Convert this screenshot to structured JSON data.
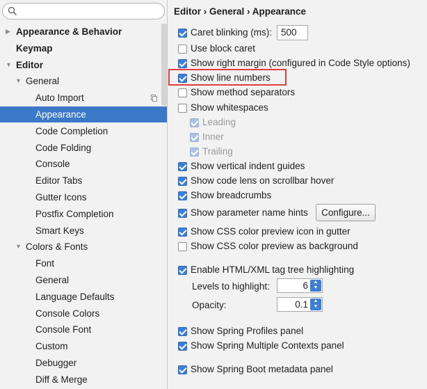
{
  "search": {
    "placeholder": ""
  },
  "tree": {
    "items": [
      {
        "label": "Appearance & Behavior",
        "arrow": "▶"
      },
      {
        "label": "Keymap",
        "arrow": ""
      },
      {
        "label": "Editor",
        "arrow": "▼"
      },
      {
        "label": "General",
        "arrow": "▼"
      },
      {
        "label": "Auto Import",
        "arrow": ""
      },
      {
        "label": "Appearance",
        "arrow": ""
      },
      {
        "label": "Code Completion",
        "arrow": ""
      },
      {
        "label": "Code Folding",
        "arrow": ""
      },
      {
        "label": "Console",
        "arrow": ""
      },
      {
        "label": "Editor Tabs",
        "arrow": ""
      },
      {
        "label": "Gutter Icons",
        "arrow": ""
      },
      {
        "label": "Postfix Completion",
        "arrow": ""
      },
      {
        "label": "Smart Keys",
        "arrow": ""
      },
      {
        "label": "Colors & Fonts",
        "arrow": "▼"
      },
      {
        "label": "Font",
        "arrow": ""
      },
      {
        "label": "General",
        "arrow": ""
      },
      {
        "label": "Language Defaults",
        "arrow": ""
      },
      {
        "label": "Console Colors",
        "arrow": ""
      },
      {
        "label": "Console Font",
        "arrow": ""
      },
      {
        "label": "Custom",
        "arrow": ""
      },
      {
        "label": "Debugger",
        "arrow": ""
      },
      {
        "label": "Diff & Merge",
        "arrow": ""
      }
    ]
  },
  "breadcrumb": "Editor › General › Appearance",
  "options": {
    "caret_blinking": {
      "label": "Caret blinking (ms):",
      "checked": true,
      "value": "500"
    },
    "block_caret": {
      "label": "Use block caret",
      "checked": false
    },
    "right_margin": {
      "label": "Show right margin (configured in Code Style options)",
      "checked": true
    },
    "line_numbers": {
      "label": "Show line numbers",
      "checked": true
    },
    "method_separators": {
      "label": "Show method separators",
      "checked": false
    },
    "whitespaces": {
      "label": "Show whitespaces",
      "checked": false
    },
    "leading": {
      "label": "Leading",
      "checked": true
    },
    "inner": {
      "label": "Inner",
      "checked": true
    },
    "trailing": {
      "label": "Trailing",
      "checked": true
    },
    "indent_guides": {
      "label": "Show vertical indent guides",
      "checked": true
    },
    "code_lens": {
      "label": "Show code lens on scrollbar hover",
      "checked": true
    },
    "breadcrumbs": {
      "label": "Show breadcrumbs",
      "checked": true
    },
    "param_hints": {
      "label": "Show parameter name hints",
      "checked": true,
      "button": "Configure..."
    },
    "css_icon": {
      "label": "Show CSS color preview icon in gutter",
      "checked": true
    },
    "css_background": {
      "label": "Show CSS color preview as background",
      "checked": false
    },
    "tag_tree": {
      "label": "Enable HTML/XML tag tree highlighting",
      "checked": true
    },
    "levels": {
      "label": "Levels to highlight:",
      "value": "6"
    },
    "opacity": {
      "label": "Opacity:",
      "value": "0.1"
    },
    "spring_profiles": {
      "label": "Show Spring Profiles panel",
      "checked": true
    },
    "spring_contexts": {
      "label": "Show Spring Multiple Contexts panel",
      "checked": true
    },
    "spring_boot": {
      "label": "Show Spring Boot metadata panel",
      "checked": true
    }
  },
  "colors": {
    "selection": "#3b78c8",
    "checkbox": "#3d7fd6",
    "highlight": "#e23d3d"
  }
}
